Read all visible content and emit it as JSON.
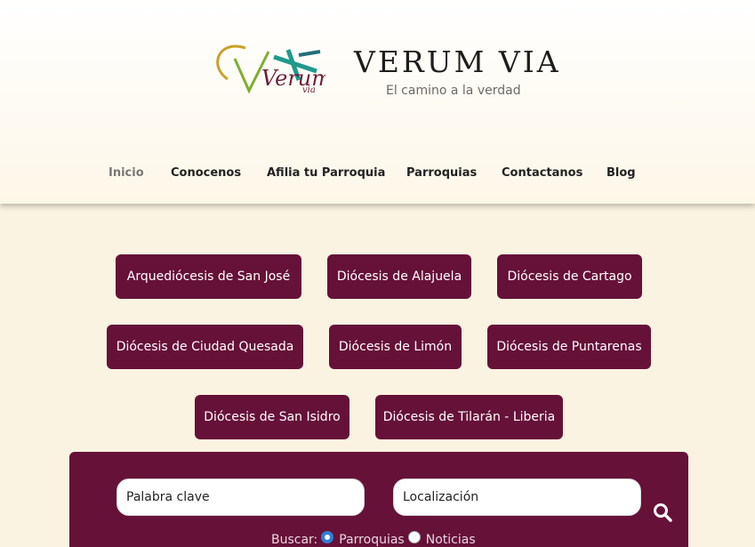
{
  "site": {
    "title": "VERUM VIA",
    "tagline": "El camino a la verdad",
    "logo_name": "verum-via-logo",
    "logo_text": "Verum",
    "logo_subtext": "via"
  },
  "nav": {
    "items": [
      {
        "label": "Inicio",
        "active": true
      },
      {
        "label": "Conocenos"
      },
      {
        "label": "Afilia tu Parroquia"
      },
      {
        "label": "Parroquias"
      },
      {
        "label": "Contactanos"
      },
      {
        "label": "Blog"
      }
    ]
  },
  "dioceses": [
    "Arquediócesis de San José",
    "Diócesis de Alajuela",
    "Diócesis de Cartago",
    "Diócesis de Ciudad Quesada",
    "Diócesis de Limón",
    "Diócesis de Puntarenas",
    "Diócesis de San Isidro",
    "Diócesis de Tilarán - Liberia"
  ],
  "search": {
    "keyword_placeholder": "Palabra clave",
    "location_placeholder": "Localización",
    "search_icon": "search-icon",
    "scope_label": "Buscar:",
    "options": [
      {
        "label": "Parroquias",
        "checked": true
      },
      {
        "label": "Noticias",
        "checked": false
      }
    ]
  },
  "colors": {
    "brand": "#661138",
    "background": "#fbf3e1",
    "radio_selected": "#2e7fd6"
  }
}
